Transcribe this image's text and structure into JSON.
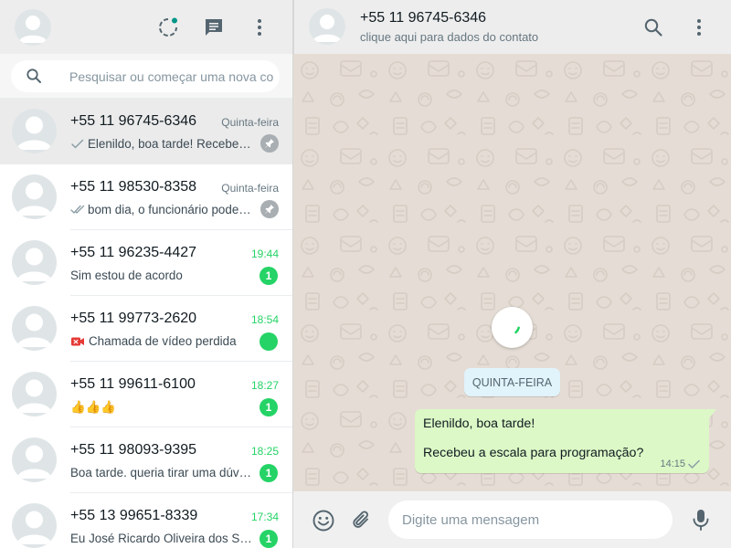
{
  "colors": {
    "accent": "#25d366",
    "header_bg": "#ededed",
    "bubble_out": "#dcf8c6",
    "date_chip": "#e1f3fb",
    "wallpaper": "#e5ddd5",
    "pin_badge": "#a8aeb2",
    "missed_call": "#e53935"
  },
  "sidebar": {
    "header": {
      "icons": [
        "avatar",
        "status-icon",
        "new-chat-icon",
        "menu-icon"
      ]
    },
    "search": {
      "placeholder": "Pesquisar ou começar uma nova conversa"
    },
    "chats": [
      {
        "name": "+55 11 96745-6346",
        "time": "Quinta-feira",
        "preview": "Elenildo, boa tarde! Recebeu a escala para programação?",
        "status_icon": "single-tick-icon",
        "pinned": true,
        "active": true
      },
      {
        "name": "+55 11 98530-8358",
        "time": "Quinta-feira",
        "preview": "bom dia, o funcionário poderia verificar",
        "status_icon": "double-tick-icon",
        "pinned": true
      },
      {
        "name": "+55 11 96235-4427",
        "time": "19:44",
        "preview": "Sim estou de acordo",
        "unread": "1"
      },
      {
        "name": "+55 11 99773-2620",
        "time": "18:54",
        "preview": "Chamada de vídeo perdida",
        "status_icon": "missed-video-call-icon",
        "unread_dot": true
      },
      {
        "name": "+55 11 99611-6100",
        "time": "18:27",
        "preview": "👍👍👍",
        "unread": "1"
      },
      {
        "name": "+55 11 98093-9395",
        "time": "18:25",
        "preview": "Boa tarde. queria tirar uma dúvida",
        "unread": "1"
      },
      {
        "name": "+55 13 99651-8339",
        "time": "17:34",
        "preview": "Eu José Ricardo Oliveira dos Santos",
        "unread": "1"
      }
    ]
  },
  "conversation": {
    "contact_name": "+55 11 96745-6346",
    "contact_subtitle": "clique aqui para dados do contato",
    "date_chip": "QUINTA-FEIRA",
    "messages": [
      {
        "line1": "Elenildo, boa tarde!",
        "line2": "Recebeu a escala para programação?",
        "time": "14:15",
        "status_icon": "single-tick-icon",
        "direction": "out"
      }
    ],
    "composer": {
      "placeholder": "Digite uma mensagem"
    }
  }
}
